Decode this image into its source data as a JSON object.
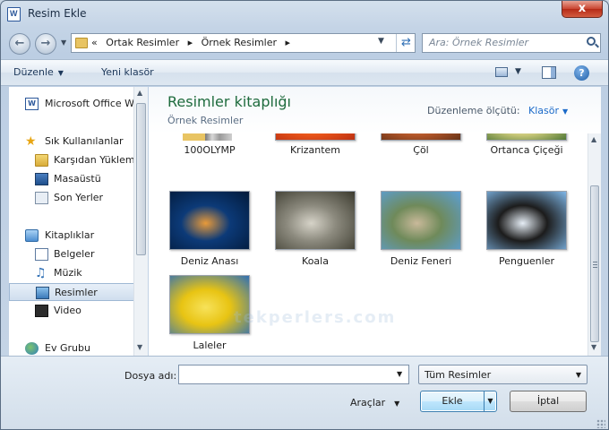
{
  "window": {
    "title": "Resim Ekle",
    "close_label": "x"
  },
  "address": {
    "prefix": "«",
    "crumbs": [
      "Ortak Resimler",
      "▸",
      "Örnek Resimler",
      "▸"
    ],
    "search_placeholder": "Ara: Örnek Resimler"
  },
  "toolbar": {
    "organize": "Düzenle",
    "new_folder": "Yeni klasör",
    "help": "?"
  },
  "nav": {
    "items": [
      {
        "label": "Microsoft Office W",
        "icon": "word-doc-icon",
        "level": "top"
      },
      {
        "label": "Sık Kullanılanlar",
        "icon": "star-icon",
        "level": "top"
      },
      {
        "label": "Karşıdan Yüklem",
        "icon": "downloads-folder-icon",
        "level": "sub"
      },
      {
        "label": "Masaüstü",
        "icon": "desktop-icon",
        "level": "sub"
      },
      {
        "label": "Son Yerler",
        "icon": "recent-places-icon",
        "level": "sub"
      },
      {
        "label": "Kitaplıklar",
        "icon": "libraries-icon",
        "level": "top"
      },
      {
        "label": "Belgeler",
        "icon": "documents-icon",
        "level": "sub"
      },
      {
        "label": "Müzik",
        "icon": "music-note-icon",
        "level": "sub"
      },
      {
        "label": "Resimler",
        "icon": "pictures-icon",
        "level": "sub",
        "selected": true
      },
      {
        "label": "Video",
        "icon": "video-icon",
        "level": "sub"
      },
      {
        "label": "Ev Grubu",
        "icon": "homegroup-icon",
        "level": "top"
      }
    ]
  },
  "library": {
    "title": "Resimler kitaplığı",
    "subtitle": "Örnek Resimler",
    "arrange_label": "Düzenleme ölçütü:",
    "arrange_value": "Klasör"
  },
  "tiles": [
    {
      "label": "100OLYMP",
      "kind": "folder"
    },
    {
      "label": "Krizantem",
      "kind": "image",
      "colors": [
        "#b52a10",
        "#e8541a",
        "#f7a12c"
      ]
    },
    {
      "label": "Çöl",
      "kind": "image",
      "colors": [
        "#5a2c14",
        "#b4572a",
        "#e69b56"
      ]
    },
    {
      "label": "Ortanca Çiçeği",
      "kind": "image",
      "colors": [
        "#3c6b2a",
        "#c9c87a",
        "#efe9b8"
      ]
    },
    {
      "label": "Deniz Anası",
      "kind": "image",
      "colors": [
        "#021a3a",
        "#0c3a78",
        "#e89a3a"
      ]
    },
    {
      "label": "Koala",
      "kind": "image",
      "colors": [
        "#3b3a2e",
        "#8c8a7e",
        "#d6d3c8"
      ]
    },
    {
      "label": "Deniz Feneri",
      "kind": "image",
      "colors": [
        "#5b9fd6",
        "#6f8a5a",
        "#c9b99a"
      ]
    },
    {
      "label": "Penguenler",
      "kind": "image",
      "colors": [
        "#7fb7e8",
        "#1c1c1c",
        "#e6eef6"
      ]
    },
    {
      "label": "Laleler",
      "kind": "image",
      "colors": [
        "#2f6fb5",
        "#e8c413",
        "#f7e25a"
      ]
    }
  ],
  "watermark": "tekperlers.com",
  "bottom": {
    "filename_label": "Dosya adı:",
    "filename_value": "",
    "filetype_value": "Tüm Resimler",
    "tools_label": "Araçlar",
    "insert_label": "Ekle",
    "cancel_label": "İptal"
  }
}
